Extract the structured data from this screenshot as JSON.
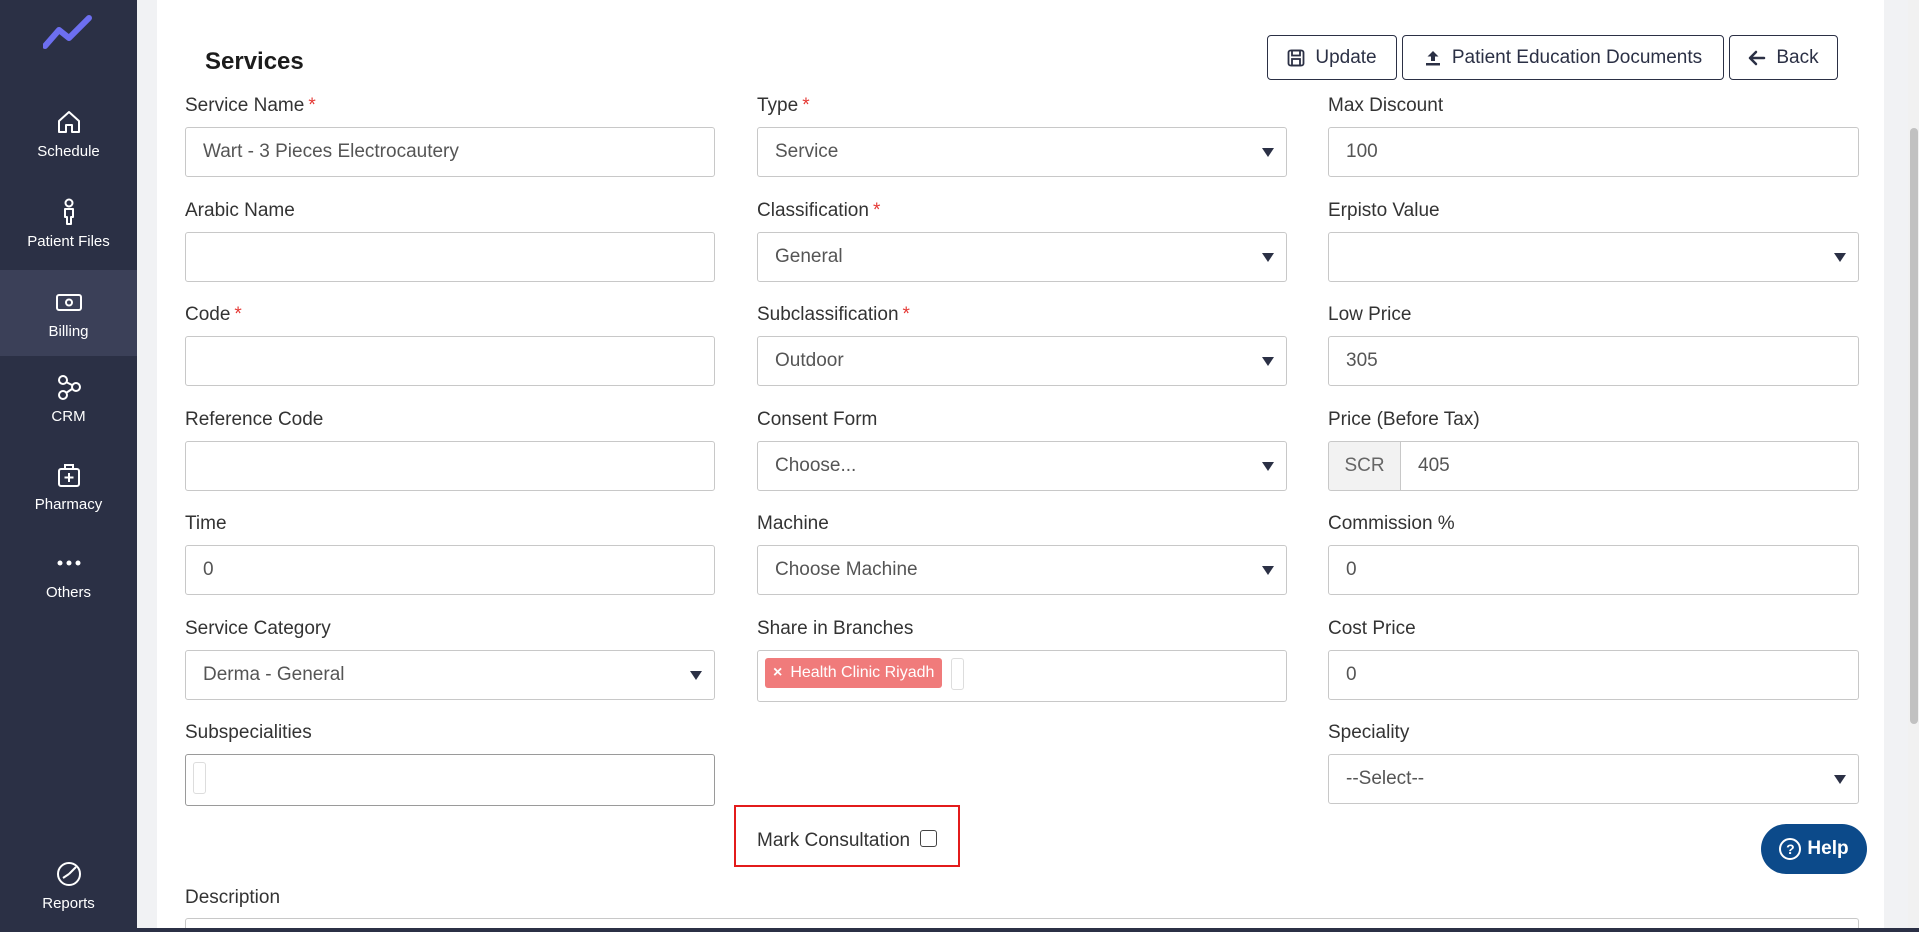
{
  "sidebar": {
    "items": [
      {
        "label": "Schedule",
        "icon": "home-icon"
      },
      {
        "label": "Patient Files",
        "icon": "person-icon"
      },
      {
        "label": "Billing",
        "icon": "billing-icon"
      },
      {
        "label": "CRM",
        "icon": "crm-icon"
      },
      {
        "label": "Pharmacy",
        "icon": "pharmacy-icon"
      },
      {
        "label": "Others",
        "icon": "more-icon"
      },
      {
        "label": "Reports",
        "icon": "reports-icon"
      }
    ],
    "active": "Billing"
  },
  "header": {
    "title": "Services",
    "update_label": "Update",
    "education_label": "Patient Education Documents",
    "back_label": "Back"
  },
  "form": {
    "service_name": {
      "label": "Service Name",
      "value": "Wart - 3 Pieces  Electrocautery"
    },
    "type": {
      "label": "Type",
      "value": "Service"
    },
    "max_discount": {
      "label": "Max Discount",
      "value": "100"
    },
    "arabic_name": {
      "label": "Arabic Name",
      "value": ""
    },
    "classification": {
      "label": "Classification",
      "value": "General"
    },
    "erpisto_value": {
      "label": "Erpisto Value",
      "value": ""
    },
    "code": {
      "label": "Code",
      "value": ""
    },
    "subclassification": {
      "label": "Subclassification",
      "value": "Outdoor"
    },
    "low_price": {
      "label": "Low Price",
      "value": "305"
    },
    "reference_code": {
      "label": "Reference Code",
      "value": ""
    },
    "consent_form": {
      "label": "Consent Form",
      "value": "Choose..."
    },
    "price": {
      "label": "Price (Before Tax)",
      "currency": "SCR",
      "value": "405"
    },
    "time": {
      "label": "Time",
      "value": "0"
    },
    "machine": {
      "label": "Machine",
      "value": "Choose Machine"
    },
    "commission": {
      "label": "Commission %",
      "value": "0"
    },
    "service_category": {
      "label": "Service Category",
      "value": "Derma - General"
    },
    "share_in_branches": {
      "label": "Share in Branches",
      "tags": [
        "Health Clinic Riyadh"
      ]
    },
    "cost_price": {
      "label": "Cost Price",
      "value": "0"
    },
    "subspecialities": {
      "label": "Subspecialities"
    },
    "speciality": {
      "label": "Speciality",
      "value": "--Select--"
    },
    "mark_consultation": {
      "label": "Mark Consultation",
      "checked": false
    },
    "description": {
      "label": "Description"
    },
    "required_marker": "*"
  },
  "help": {
    "label": "Help"
  },
  "colors": {
    "sidebar_bg": "#2b3045",
    "accent": "#0c4a8a",
    "required": "#e53935",
    "tag_bg": "#f07b7b",
    "highlight": "#e31b1b"
  }
}
